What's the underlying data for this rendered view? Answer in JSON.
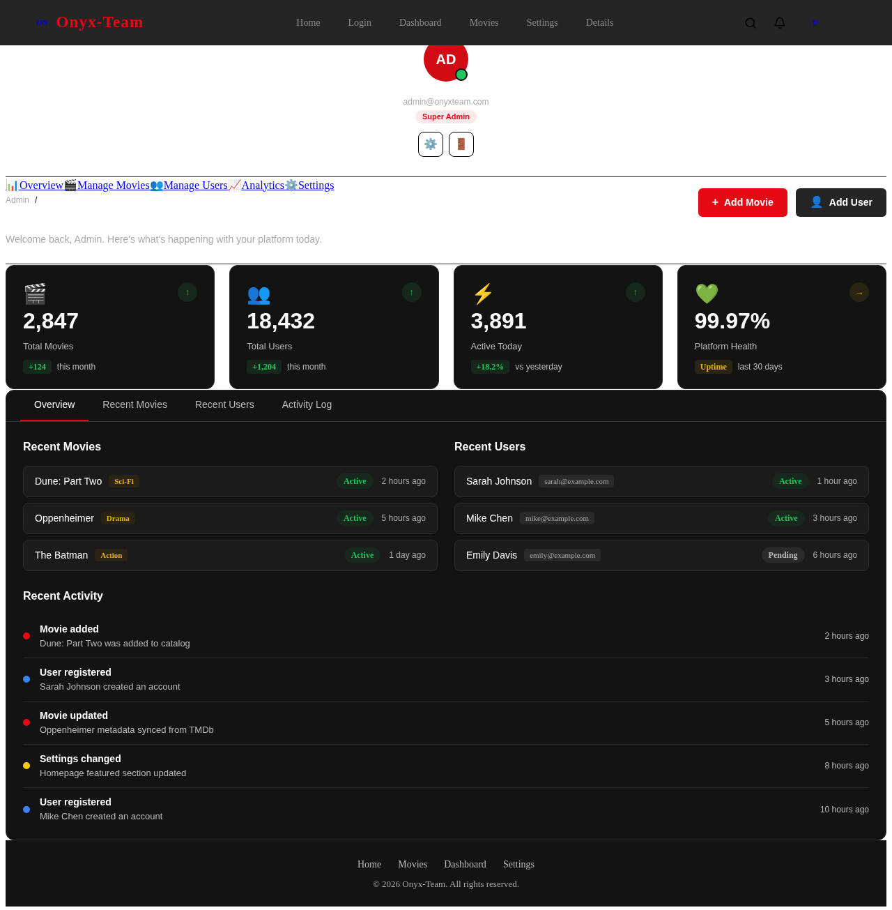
{
  "header": {
    "logo_mark": "ON",
    "brand": "Onyx-Team",
    "nav": [
      "Home",
      "Login",
      "Dashboard",
      "Movies",
      "Settings",
      "Details"
    ],
    "user_link": "U"
  },
  "profile": {
    "initials": "AD",
    "online": true,
    "email": "admin@onyxteam.com",
    "role": "Super Admin",
    "actions": [
      "⚙️",
      "🚪"
    ]
  },
  "section_nav": [
    {
      "icon": "📊",
      "label": "Overview"
    },
    {
      "icon": "🎬",
      "label": "Manage Movies"
    },
    {
      "icon": "👥",
      "label": "Manage Users"
    },
    {
      "icon": "📈",
      "label": "Analytics"
    },
    {
      "icon": "⚙️",
      "label": "Settings"
    }
  ],
  "breadcrumb": [
    "Admin",
    "/"
  ],
  "buttons": [
    {
      "kind": "primary",
      "icon": "+",
      "label": "Add Movie"
    },
    {
      "kind": "secondary",
      "icon": "👤",
      "label": "Add User"
    }
  ],
  "welcome": "Welcome back, Admin. Here's what's happening with your platform today.",
  "stats": [
    {
      "icon": "🎬",
      "trend": "↑",
      "kind": "up",
      "value": "2,847",
      "label": "Total Movies",
      "badge": "+124",
      "note": "this month"
    },
    {
      "icon": "👥",
      "trend": "↑",
      "kind": "up",
      "value": "18,432",
      "label": "Total Users",
      "badge": "+1,204",
      "note": "this month"
    },
    {
      "icon": "⚡",
      "trend": "↑",
      "kind": "up",
      "value": "3,891",
      "label": "Active Today",
      "badge": "+18.2%",
      "note": "vs yesterday"
    },
    {
      "icon": "💚",
      "trend": "→",
      "kind": "steady",
      "value": "99.97%",
      "label": "Platform Health",
      "badge": "Uptime",
      "note": "last 30 days"
    }
  ],
  "tabs": [
    {
      "label": "Overview",
      "selected": true
    },
    {
      "label": "Recent Movies",
      "selected": false
    },
    {
      "label": "Recent Users",
      "selected": false
    },
    {
      "label": "Activity Log",
      "selected": false
    }
  ],
  "recent_movies": {
    "title": "Recent Movies",
    "items": [
      {
        "name": "Dune: Part Two",
        "tag": "Sci-Fi",
        "status": "Active",
        "kind": "active",
        "time": "2 hours ago"
      },
      {
        "name": "Oppenheimer",
        "tag": "Drama",
        "status": "Active",
        "kind": "active",
        "time": "5 hours ago"
      },
      {
        "name": "The Batman",
        "tag": "Action",
        "status": "Active",
        "kind": "active",
        "time": "1 day ago"
      }
    ]
  },
  "recent_users": {
    "title": "Recent Users",
    "items": [
      {
        "name": "Sarah Johnson",
        "tag": "sarah@example.com",
        "status": "Active",
        "kind": "active",
        "time": "1 hour ago"
      },
      {
        "name": "Mike Chen",
        "tag": "mike@example.com",
        "status": "Active",
        "kind": "active",
        "time": "3 hours ago"
      },
      {
        "name": "Emily Davis",
        "tag": "emily@example.com",
        "status": "Pending",
        "kind": "pending",
        "time": "6 hours ago"
      }
    ]
  },
  "recent_activity": {
    "title": "Recent Activity",
    "items": [
      {
        "color": "#e50914",
        "title": "Movie added",
        "detail": "Dune: Part Two was added to catalog",
        "time": "2 hours ago"
      },
      {
        "color": "#3b82f6",
        "title": "User registered",
        "detail": "Sarah Johnson created an account",
        "time": "3 hours ago"
      },
      {
        "color": "#e50914",
        "title": "Movie updated",
        "detail": "Oppenheimer metadata synced from TMDb",
        "time": "5 hours ago"
      },
      {
        "color": "#facc15",
        "title": "Settings changed",
        "detail": "Homepage featured section updated",
        "time": "8 hours ago"
      },
      {
        "color": "#3b82f6",
        "title": "User registered",
        "detail": "Mike Chen created an account",
        "time": "10 hours ago"
      }
    ]
  },
  "footer": {
    "links": [
      "Home",
      "Movies",
      "Dashboard",
      "Settings"
    ],
    "copyright": "© 2026 Onyx-Team. All rights reserved."
  }
}
